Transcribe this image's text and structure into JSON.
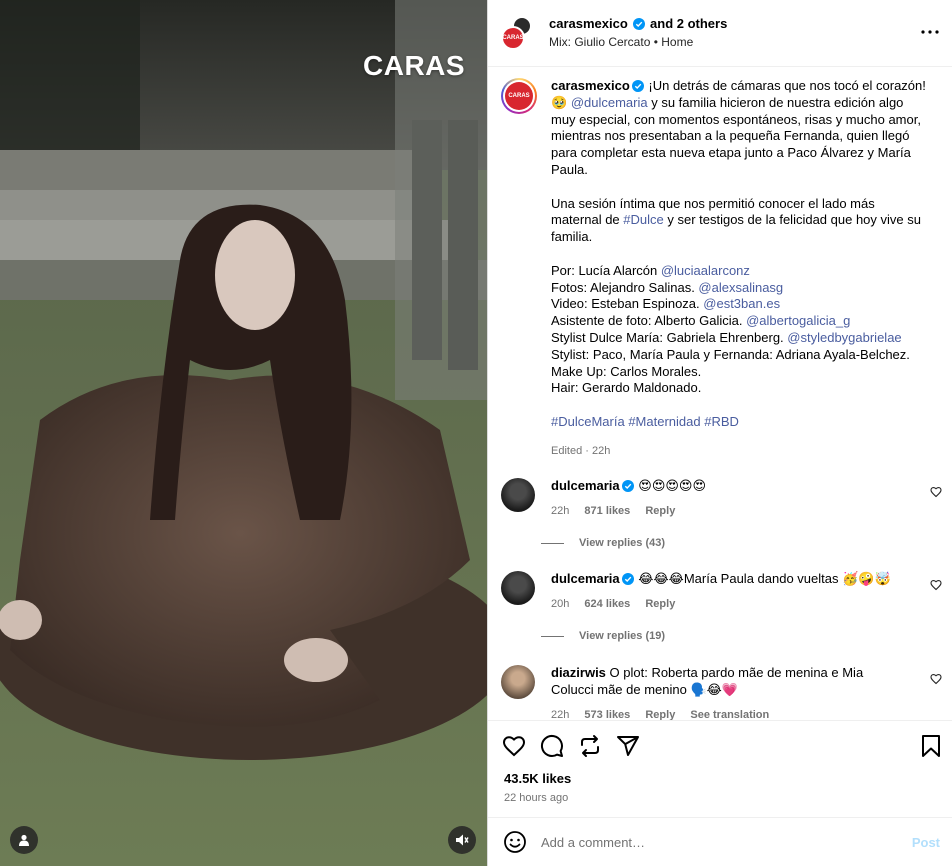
{
  "media": {
    "brand_text": "CARAS",
    "user_tag_icon": "person-icon",
    "mute_icon": "speaker-muted-icon"
  },
  "header": {
    "username": "carasmexico",
    "others": "and 2 others",
    "audio": "Mix: Giulio Cercato • Home",
    "logo_text": "CARAS"
  },
  "caption": {
    "username": "carasmexico",
    "intro": " ¡Un detrás de cámaras que nos tocó el corazón!",
    "emoji": "🥹",
    "mention": "@dulcemaria",
    "text1": " y su familia hicieron de nuestra edición algo muy especial, con momentos espontáneos, risas y mucho amor, mientras nos presentaban a la pequeña Fernanda, quien llegó para completar esta nueva etapa junto a Paco Álvarez y María Paula.",
    "p2_a": "Una sesión íntima que nos permitió conocer el lado más maternal de ",
    "p2_tag": "#Dulce",
    "p2_b": " y ser testigos de la felicidad que hoy vive su familia.",
    "credits": [
      {
        "label": "Por: Lucía Alarcón ",
        "handle": "@luciaalarconz"
      },
      {
        "label": "Fotos: Alejandro Salinas. ",
        "handle": "@alexsalinasg"
      },
      {
        "label": "Video: Esteban Espinoza. ",
        "handle": "@est3ban.es"
      },
      {
        "label": "Asistente de foto: Alberto Galicia. ",
        "handle": "@albertogalicia_g"
      },
      {
        "label": "Stylist Dulce María: Gabriela Ehrenberg. ",
        "handle": "@styledbygabrielae"
      },
      {
        "label": "Stylist: Paco, María Paula y Fernanda: Adriana Ayala-Belchez.",
        "handle": ""
      },
      {
        "label": "Make Up: Carlos Morales.",
        "handle": ""
      },
      {
        "label": "Hair: Gerardo Maldonado.",
        "handle": ""
      }
    ],
    "hashtags": [
      "#DulceMaría",
      "#Maternidad",
      "#RBD"
    ],
    "edited": "Edited · 22h"
  },
  "comments": [
    {
      "username": "dulcemaria",
      "text": " 😍😍😍😍😍",
      "time": "22h",
      "likes": "871 likes",
      "reply": "Reply",
      "view_replies": "View replies (43)"
    },
    {
      "username": "dulcemaria",
      "text": " 😂😂😂María Paula dando vueltas 🥳🤪🤯",
      "time": "20h",
      "likes": "624 likes",
      "reply": "Reply",
      "view_replies": "View replies (19)"
    },
    {
      "username": "diazirwis",
      "text": " O plot: Roberta pardo mãe de menina e Mia Colucci mãe de menino 🗣️😂💗",
      "time": "22h",
      "likes": "573 likes",
      "reply": "Reply",
      "translate": "See translation"
    }
  ],
  "actions": {
    "like_icon": "heart-icon",
    "comment_icon": "comment-icon",
    "share_icon": "repost-icon",
    "send_icon": "send-icon",
    "save_icon": "bookmark-icon"
  },
  "likes_count": "43.5K likes",
  "time_ago": "22 hours ago",
  "add_comment": {
    "placeholder": "Add a comment…",
    "post_label": "Post"
  }
}
